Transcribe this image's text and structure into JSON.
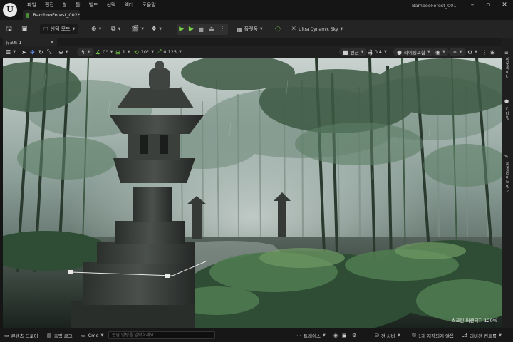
{
  "app": {
    "logo": "U",
    "project_name": "BambooForest_001"
  },
  "menu": [
    "파일",
    "편집",
    "창",
    "툴",
    "빌드",
    "선택",
    "액터",
    "도움말"
  ],
  "document_tab": {
    "label": "BambooForest_002*"
  },
  "window_controls": [
    "–",
    "▫",
    "✕"
  ],
  "toolbar": {
    "mode_label": "선택 모드",
    "platform_label": "플랫폼",
    "sky_label": "Ultra Dynamic Sky"
  },
  "viewport_tab": {
    "label": "뷰포트 1",
    "close": "×"
  },
  "viewport_toolbar": {
    "snap_angle": "0°",
    "snap_grid": "1",
    "rotation_snap": "10°",
    "scale_snap": "0.125",
    "perspective_label": "원근",
    "camera_speed": "0.4",
    "lit_label": "라이팅포함"
  },
  "viewport_overlay": {
    "text": "스크린 퍼센티지 120%"
  },
  "right_panel": {
    "tabs": [
      "아웃라이너",
      "디테일",
      "환경라이트 믹서"
    ]
  },
  "statusbar": {
    "content_drawer": "콘텐츠 드로어",
    "output_log": "출력 로그",
    "cmd_label": "Cmd",
    "cmd_placeholder": "콘솔 명령을 입력하세요",
    "trace_label": "트레이스",
    "derived_data": "전 서버",
    "unsaved": "1개 저장되지 않음",
    "revision_control": "리비전 컨트롤"
  },
  "colors": {
    "titlebar_bg": "#151515",
    "toolbar_bg": "#242424",
    "play_green": "#7ad14a",
    "accent_green": "#4a8b3a"
  }
}
